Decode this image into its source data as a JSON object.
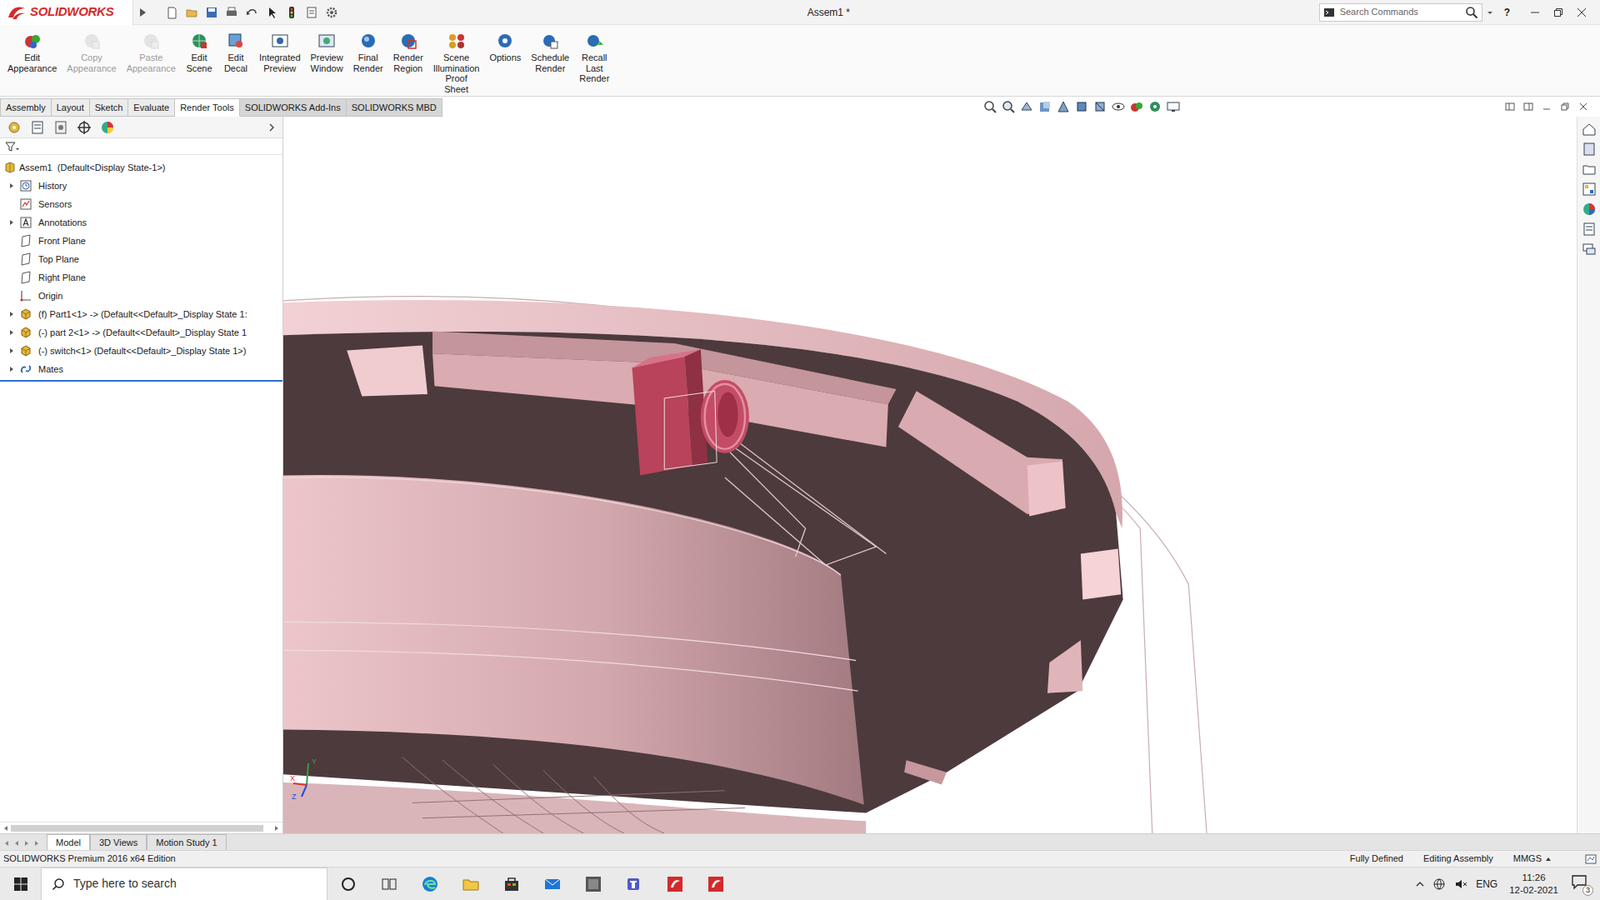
{
  "window": {
    "logo": "SOLIDWORKS",
    "title": "Assem1 *",
    "help": "?"
  },
  "search": {
    "placeholder": "Search Commands"
  },
  "ribbon": [
    {
      "label": "Edit Appearance",
      "disabled": false
    },
    {
      "label": "Copy Appearance",
      "disabled": true
    },
    {
      "label": "Paste Appearance",
      "disabled": true
    },
    {
      "label": "Edit Scene",
      "disabled": false
    },
    {
      "label": "Edit Decal",
      "disabled": false
    },
    {
      "label": "Integrated Preview",
      "disabled": false
    },
    {
      "label": "Preview Window",
      "disabled": false
    },
    {
      "label": "Final Render",
      "disabled": false
    },
    {
      "label": "Render Region",
      "disabled": false
    },
    {
      "label": "Scene Illumination Proof Sheet",
      "disabled": false
    },
    {
      "label": "Options",
      "disabled": false
    },
    {
      "label": "Schedule Render",
      "disabled": false
    },
    {
      "label": "Recall Last Render",
      "disabled": false
    }
  ],
  "tabs": [
    {
      "label": "Assembly",
      "selected": false
    },
    {
      "label": "Layout",
      "selected": false
    },
    {
      "label": "Sketch",
      "selected": false
    },
    {
      "label": "Evaluate",
      "selected": false
    },
    {
      "label": "Render Tools",
      "selected": true
    },
    {
      "label": "SOLIDWORKS Add-Ins",
      "selected": false
    },
    {
      "label": "SOLIDWORKS MBD",
      "selected": false
    }
  ],
  "tree": {
    "root": "Assem1  (Default<Display State-1>)",
    "items": [
      {
        "label": "History",
        "kind": "folder",
        "expandable": true
      },
      {
        "label": "Sensors",
        "kind": "sensor",
        "expandable": false
      },
      {
        "label": "Annotations",
        "kind": "annotation",
        "expandable": true
      },
      {
        "label": "Front Plane",
        "kind": "plane",
        "expandable": false
      },
      {
        "label": "Top Plane",
        "kind": "plane",
        "expandable": false
      },
      {
        "label": "Right Plane",
        "kind": "plane",
        "expandable": false
      },
      {
        "label": "Origin",
        "kind": "origin",
        "expandable": false
      },
      {
        "label": "(f) Part1<1> -> (Default<<Default>_Display State 1:",
        "kind": "component",
        "expandable": true
      },
      {
        "label": "(-) part 2<1> -> (Default<<Default>_Display State 1",
        "kind": "component",
        "expandable": true
      },
      {
        "label": "(-) switch<1> (Default<<Default>_Display State 1>)",
        "kind": "component",
        "expandable": true
      },
      {
        "label": "Mates",
        "kind": "mates",
        "expandable": true
      }
    ]
  },
  "viewport": {
    "triad": {
      "x": "X",
      "y": "Y",
      "z": "Z"
    }
  },
  "bottom_tabs": [
    {
      "label": "Model",
      "selected": true
    },
    {
      "label": "3D Views",
      "selected": false
    },
    {
      "label": "Motion Study 1",
      "selected": false
    }
  ],
  "status_bar": {
    "edition": "SOLIDWORKS Premium 2016 x64 Edition",
    "fields": [
      "Fully Defined",
      "Editing Assembly",
      "MMGS"
    ]
  },
  "taskbar": {
    "search": "Type here to search",
    "language": "ENG",
    "time": "11:26",
    "date": "12-02-2021",
    "notifications": "3"
  }
}
